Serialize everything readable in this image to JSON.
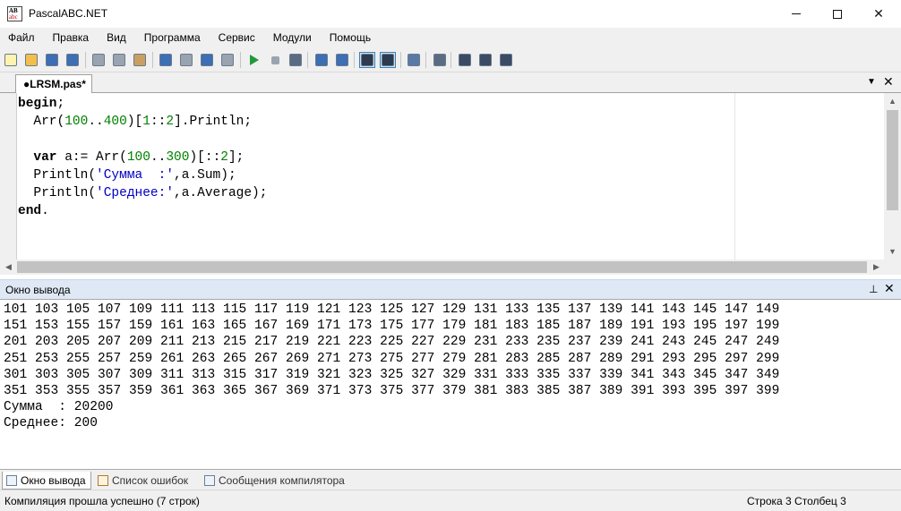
{
  "window": {
    "title": "PascalABC.NET",
    "icon_top": "AB",
    "icon_bottom": "abc",
    "minimize_icon": "minimize-icon",
    "maximize_icon": "maximize-icon",
    "close_glyph": "✕"
  },
  "menu": [
    "Файл",
    "Правка",
    "Вид",
    "Программа",
    "Сервис",
    "Модули",
    "Помощь"
  ],
  "toolbar": {
    "icons": [
      "new-file-icon",
      "open-icon",
      "save-icon",
      "save-all-icon",
      "cut-icon",
      "copy-icon",
      "paste-icon",
      "undo-icon",
      "redo-icon",
      "format-left-icon",
      "format-right-icon",
      "run-icon",
      "stop-icon",
      "debug-icon",
      "comment-icon",
      "uncomment-icon",
      "console-icon",
      "text-icon",
      "navigate-icon",
      "grid-icon",
      "module-a-icon",
      "module-b-icon",
      "module-c-icon"
    ]
  },
  "tabs": {
    "active": "●LRSM.pas*",
    "dropdown_glyph": "▼",
    "close_glyph": "✕"
  },
  "editor": {
    "lines": [
      [
        {
          "t": "kw",
          "v": "begin"
        },
        {
          "t": "p",
          "v": ";"
        }
      ],
      [
        {
          "t": "p",
          "v": "  Arr("
        },
        {
          "t": "num",
          "v": "100"
        },
        {
          "t": "p",
          "v": ".."
        },
        {
          "t": "num",
          "v": "400"
        },
        {
          "t": "p",
          "v": ")["
        },
        {
          "t": "num",
          "v": "1"
        },
        {
          "t": "p",
          "v": "::"
        },
        {
          "t": "num",
          "v": "2"
        },
        {
          "t": "p",
          "v": "].Println;"
        }
      ],
      [
        {
          "t": "p",
          "v": ""
        }
      ],
      [
        {
          "t": "p",
          "v": "  "
        },
        {
          "t": "kw",
          "v": "var"
        },
        {
          "t": "p",
          "v": " a:= Arr("
        },
        {
          "t": "num",
          "v": "100"
        },
        {
          "t": "p",
          "v": ".."
        },
        {
          "t": "num",
          "v": "300"
        },
        {
          "t": "p",
          "v": ")[::"
        },
        {
          "t": "num",
          "v": "2"
        },
        {
          "t": "p",
          "v": "];"
        }
      ],
      [
        {
          "t": "p",
          "v": "  Println("
        },
        {
          "t": "str",
          "v": "'Сумма  :'"
        },
        {
          "t": "p",
          "v": ",a.Sum);"
        }
      ],
      [
        {
          "t": "p",
          "v": "  Println("
        },
        {
          "t": "str",
          "v": "'Среднее:'"
        },
        {
          "t": "p",
          "v": ",a.Average);"
        }
      ],
      [
        {
          "t": "kw",
          "v": "end"
        },
        {
          "t": "p",
          "v": "."
        }
      ]
    ]
  },
  "output_panel": {
    "title": "Окно вывода",
    "pin_glyph": "📌",
    "close_glyph": "✕",
    "lines": [
      "101 103 105 107 109 111 113 115 117 119 121 123 125 127 129 131 133 135 137 139 141 143 145 147 149",
      "151 153 155 157 159 161 163 165 167 169 171 173 175 177 179 181 183 185 187 189 191 193 195 197 199",
      "201 203 205 207 209 211 213 215 217 219 221 223 225 227 229 231 233 235 237 239 241 243 245 247 249",
      "251 253 255 257 259 261 263 265 267 269 271 273 275 277 279 281 283 285 287 289 291 293 295 297 299",
      "301 303 305 307 309 311 313 315 317 319 321 323 325 327 329 331 333 335 337 339 341 343 345 347 349",
      "351 353 355 357 359 361 363 365 367 369 371 373 375 377 379 381 383 385 387 389 391 393 395 397 399",
      "Сумма  : 20200",
      "Среднее: 200"
    ]
  },
  "bottom_tabs": [
    "Окно вывода",
    "Список ошибок",
    "Сообщения компилятора"
  ],
  "status": {
    "message": "Компиляция прошла успешно (7 строк)",
    "position": "Строка  3   Столбец  3"
  }
}
